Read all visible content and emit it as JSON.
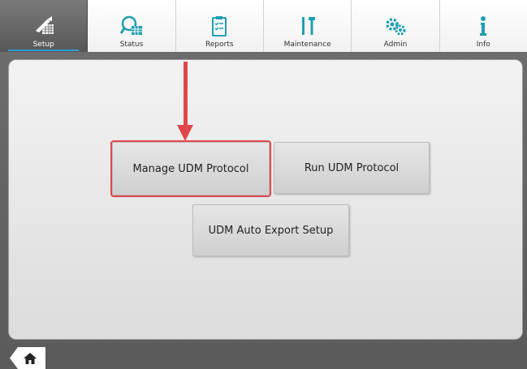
{
  "nav": {
    "tabs": [
      {
        "label": "Setup",
        "icon": "setup-icon",
        "active": true
      },
      {
        "label": "Status",
        "icon": "status-icon",
        "active": false
      },
      {
        "label": "Reports",
        "icon": "reports-icon",
        "active": false
      },
      {
        "label": "Maintenance",
        "icon": "maintenance-icon",
        "active": false
      },
      {
        "label": "Admin",
        "icon": "admin-icon",
        "active": false
      },
      {
        "label": "Info",
        "icon": "info-icon",
        "active": false
      }
    ]
  },
  "main": {
    "manage_label": "Manage UDM Protocol",
    "run_label": "Run UDM Protocol",
    "export_label": "UDM Auto Export Setup"
  },
  "colors": {
    "accent": "#2e9bd6",
    "highlight": "#e0474c",
    "icon_teal": "#1f9fb0"
  }
}
